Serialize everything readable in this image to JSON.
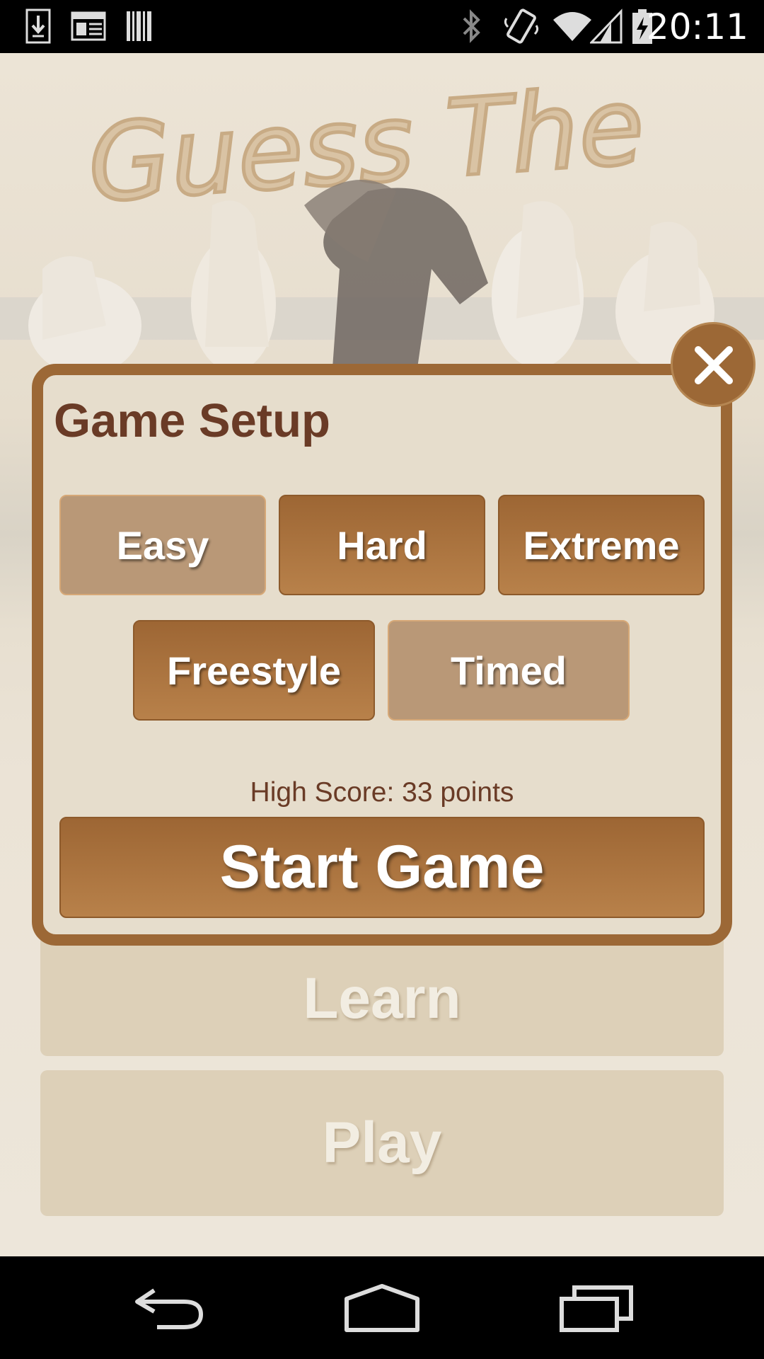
{
  "status_bar": {
    "time": "20:11",
    "left_icons": [
      "download-icon",
      "news-icon",
      "barcode-icon"
    ],
    "right_icons": [
      "bluetooth-icon",
      "vibrate-icon",
      "wifi-icon",
      "signal-icon",
      "battery-charging-icon"
    ]
  },
  "app": {
    "title_art": "Guess The"
  },
  "background_buttons": {
    "learn_label": "Learn",
    "play_label": "Play"
  },
  "dialog": {
    "title": "Game Setup",
    "modes_row1": [
      {
        "label": "Easy",
        "selected": false
      },
      {
        "label": "Hard",
        "selected": true
      },
      {
        "label": "Extreme",
        "selected": true
      }
    ],
    "modes_row2": [
      {
        "label": "Freestyle",
        "selected": true
      },
      {
        "label": "Timed",
        "selected": false
      }
    ],
    "high_score": "High Score: 33 points",
    "start_label": "Start Game",
    "close_icon": "close-icon"
  },
  "nav_bar": {
    "icons": [
      "back-icon",
      "home-icon",
      "recents-icon"
    ]
  },
  "colors": {
    "accent": "#9c6836",
    "title_text": "#6a3b26",
    "inactive_button": "#b99877",
    "dialog_bg": "#e6ddcc"
  }
}
